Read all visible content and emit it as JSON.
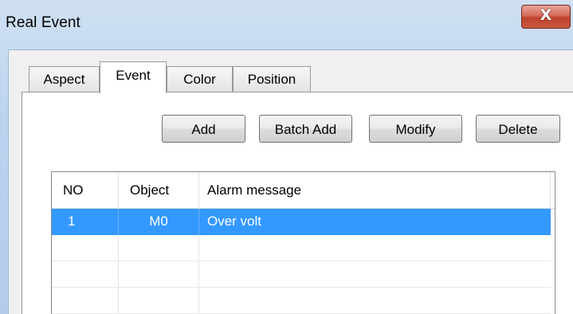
{
  "window": {
    "title": "Real Event",
    "close_glyph": "X"
  },
  "tabs": [
    {
      "label": "Aspect",
      "active": false
    },
    {
      "label": "Event",
      "active": true
    },
    {
      "label": "Color",
      "active": false
    },
    {
      "label": "Position",
      "active": false
    }
  ],
  "toolbar": {
    "add_label": "Add",
    "batch_add_label": "Batch Add",
    "modify_label": "Modify",
    "delete_label": "Delete"
  },
  "table": {
    "columns": [
      "NO",
      "Object",
      "Alarm message"
    ],
    "rows": [
      {
        "no": "1",
        "object": "M0",
        "message": "Over volt",
        "selected": true
      },
      {
        "no": "",
        "object": "",
        "message": "",
        "selected": false
      },
      {
        "no": "",
        "object": "",
        "message": "",
        "selected": false
      },
      {
        "no": "",
        "object": "",
        "message": "",
        "selected": false
      }
    ]
  },
  "colors": {
    "selection": "#3399ff",
    "close_button": "#c0422c",
    "title_bar": "#bcd3ee"
  }
}
